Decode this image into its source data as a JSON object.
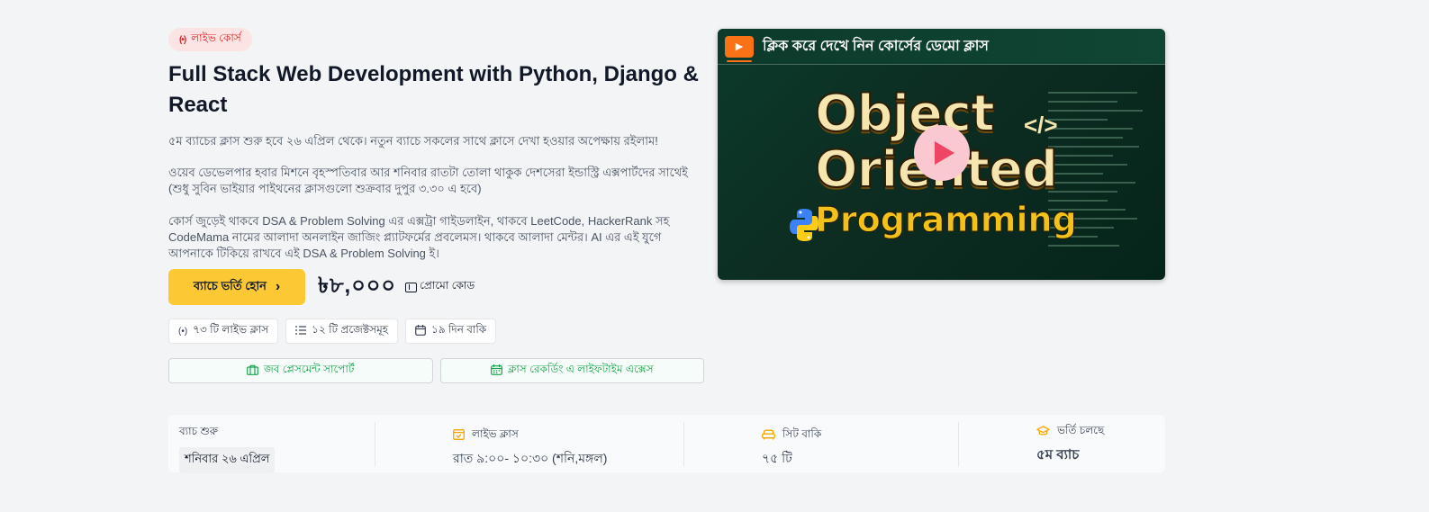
{
  "badge": {
    "label": "লাইভ কোর্স",
    "icon": "live-broadcast-icon"
  },
  "course": {
    "title": "Full Stack Web Development with Python, Django & React",
    "paragraph_1": "৫ম ব্যাচের ক্লাস শুরু হবে ২৬ এপ্রিল থেকে। নতুন ব্যাচে সকলের সাথে ক্লাসে দেখা হওয়ার অপেক্ষায় রইলাম!",
    "paragraph_2": "ওয়েব ডেভেলপার হবার মিশনে বৃহস্পতিবার আর শনিবার রাতটা তোলা থাকুক দেশসেরা ইন্ডাস্ট্রি এক্সপার্টদের সাথেই (শুধু সুবিন ভাইয়ার পাইথনের ক্লাসগুলো শুক্রবার দুপুর ৩.৩০ এ হবে)",
    "paragraph_3": "কোর্স জুড়েই থাকবে DSA & Problem Solving এর এক্সট্রা গাইডলাইন, থাকবে LeetCode, HackerRank সহ CodeMama নামের আলাদা অনলাইন জাজিং প্ল্যাটফর্মের প্রবলেমস। থাকবে আলাদা মেন্টর। AI এর এই যুগে আপনাকে টিকিয়ে রাখবে এই DSA & Problem Solving ই।"
  },
  "cta": {
    "enroll_label": "ব্যাচে ভর্তি হোন",
    "enroll_icon": "chevron-right-icon",
    "price": "৳৮,০০০",
    "promo_label": "প্রোমো কোড",
    "promo_icon": "ticket-icon"
  },
  "chips": [
    {
      "label": "৭৩ টি লাইভ ক্লাস",
      "icon": "live-broadcast-icon"
    },
    {
      "label": "১২ টি প্রজেক্টসমূহ",
      "icon": "list-icon"
    },
    {
      "label": "১৯ দিন বাকি",
      "icon": "calendar-icon"
    }
  ],
  "features": [
    {
      "label": "জব প্লেসমেন্ট সাপোর্ট",
      "icon": "briefcase-icon"
    },
    {
      "label": "ক্লাস রেকর্ডিং এ লাইফটাইম এক্সেস",
      "icon": "calendar-icon"
    }
  ],
  "video": {
    "caption": "ক্লিক করে দেখে নিন কোর্সের ডেমো ক্লাস",
    "thumb_line_1": "Object",
    "thumb_line_2": "Oriented",
    "thumb_line_3": "Programming",
    "thumb_tag": "</>",
    "play_icon": "play-icon",
    "accent_color": "#ef4565"
  },
  "info": {
    "batch_start_label": "ব্যাচ শুরু",
    "batch_start_value": "শনিবার ২৬ এপ্রিল",
    "live_class_label": "লাইভ ক্লাস",
    "live_class_value": "রাত ৯:০০- ১০:৩০ (শনি,মঙ্গল)",
    "seats_label": "সিট বাকি",
    "seats_value": "৭৫ টি",
    "admission_label": "ভর্তি চলছে",
    "admission_value": "৫ম ব্যাচ"
  },
  "colors": {
    "primary_yellow": "#fcc934",
    "live_red": "#dc2626",
    "feature_green": "#16a34a",
    "info_icon": "#f5a700"
  }
}
